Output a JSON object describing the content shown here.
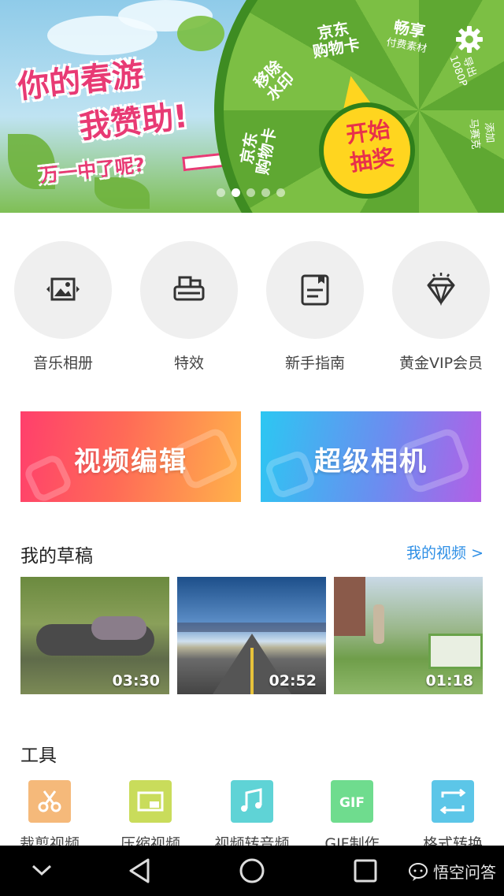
{
  "banner": {
    "line1": "你的春游",
    "line2": "我赞助!",
    "line3": "万一中了呢?",
    "wheel_segments": [
      {
        "main": "京东",
        "sub": "购物卡"
      },
      {
        "main": "畅享",
        "sub": "付费素材"
      },
      {
        "main": "移除",
        "sub": "水印"
      },
      {
        "main": "京东",
        "sub": "购物卡"
      },
      {
        "main": "导出",
        "sub": "1080P"
      },
      {
        "main": "添加",
        "sub": "马赛克"
      }
    ],
    "hub_line1": "开始",
    "hub_line2": "抽奖",
    "dot_count": 5,
    "active_dot": 1
  },
  "quick_entries": [
    {
      "label": "音乐相册",
      "icon": "photo-album-icon"
    },
    {
      "label": "特效",
      "icon": "effects-icon"
    },
    {
      "label": "新手指南",
      "icon": "guide-icon"
    },
    {
      "label": "黄金VIP会员",
      "icon": "diamond-icon"
    }
  ],
  "cards": {
    "video_edit": "视频编辑",
    "super_camera": "超级相机"
  },
  "drafts": {
    "title": "我的草稿",
    "link": "我的视频 >",
    "items": [
      {
        "duration": "03:30"
      },
      {
        "duration": "02:52"
      },
      {
        "duration": "01:18"
      }
    ]
  },
  "tools": {
    "title": "工具",
    "items": [
      {
        "label": "裁剪视频",
        "icon": "scissors-icon",
        "color": "#f5b97a"
      },
      {
        "label": "压缩视频",
        "icon": "compress-icon",
        "color": "#c9dc5b"
      },
      {
        "label": "视频转音频",
        "icon": "music-note-icon",
        "color": "#5fd3d6"
      },
      {
        "label": "GIF制作",
        "icon": "gif-icon",
        "color": "#6fdc8e"
      },
      {
        "label": "格式转换",
        "icon": "convert-icon",
        "color": "#5cc6e8"
      }
    ]
  },
  "watermark": "悟空问答",
  "colors": {
    "accent_link": "#2e8fe6",
    "edit_card_start": "#ff3f6c",
    "edit_card_end": "#ffb24a",
    "camera_card_start": "#2cc7f2",
    "camera_card_end": "#b35fe6"
  }
}
